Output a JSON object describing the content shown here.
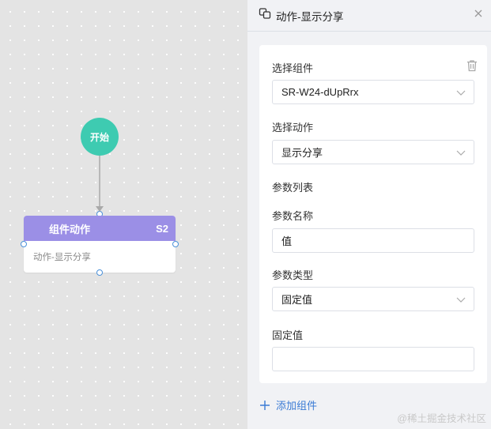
{
  "canvas": {
    "start_node_label": "开始",
    "action_node": {
      "title": "组件动作",
      "tag": "S2",
      "body": "动作-显示分享"
    }
  },
  "panel": {
    "title": "动作-显示分享",
    "card": {
      "select_component_label": "选择组件",
      "select_component_value": "SR-W24-dUpRrx",
      "select_action_label": "选择动作",
      "select_action_value": "显示分享",
      "param_list_label": "参数列表",
      "param_name_label": "参数名称",
      "param_name_value": "值",
      "param_type_label": "参数类型",
      "param_type_value": "固定值",
      "fixed_value_label": "固定值",
      "fixed_value_value": ""
    },
    "add_component_label": "添加组件"
  },
  "watermark": "@稀土掘金技术社区",
  "colors": {
    "start_node": "#3ecbb1",
    "action_node_header": "#9b8fe6",
    "port_border": "#4a90d9",
    "link_accent": "#3a7bd5",
    "panel_bg": "#f1f2f5"
  },
  "icons": {
    "header": "link-icon",
    "close": "close-icon",
    "delete": "trash-icon",
    "dropdown": "chevron-down-icon",
    "add": "plus-icon"
  }
}
